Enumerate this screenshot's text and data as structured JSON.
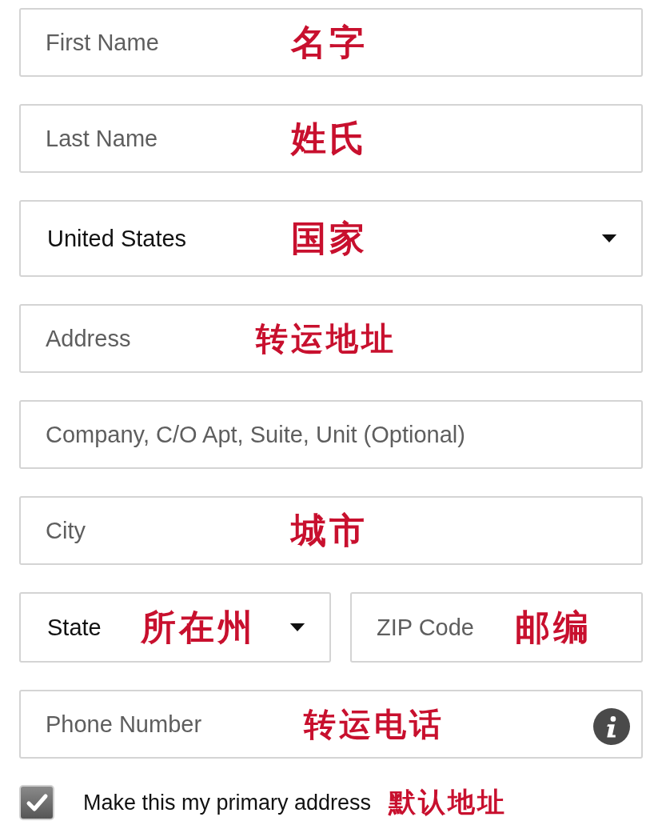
{
  "rows": [
    {
      "fields": [
        {
          "kind": "text",
          "placeholder": "First Name",
          "note": "名字"
        }
      ]
    },
    {
      "fields": [
        {
          "kind": "text",
          "placeholder": "Last Name",
          "note": "姓氏"
        }
      ]
    },
    {
      "fields": [
        {
          "kind": "select",
          "value": "United States",
          "note": "国家"
        }
      ]
    },
    {
      "fields": [
        {
          "kind": "text",
          "placeholder": "Address",
          "note": "转运地址"
        }
      ]
    },
    {
      "fields": [
        {
          "kind": "text",
          "placeholder": "Company, C/O Apt, Suite, Unit (Optional)"
        }
      ]
    },
    {
      "fields": [
        {
          "kind": "text",
          "placeholder": "City",
          "note": "城市"
        }
      ]
    },
    {
      "fields": [
        {
          "kind": "select",
          "value": "State",
          "note": "所在州"
        },
        {
          "kind": "text",
          "placeholder": "ZIP Code",
          "note": "邮编"
        }
      ]
    },
    {
      "fields": [
        {
          "kind": "text",
          "placeholder": "Phone Number",
          "note": "转运电话",
          "info": true
        }
      ]
    }
  ],
  "primary": {
    "checked": true,
    "label": "Make this my primary address",
    "note": "默认地址"
  }
}
